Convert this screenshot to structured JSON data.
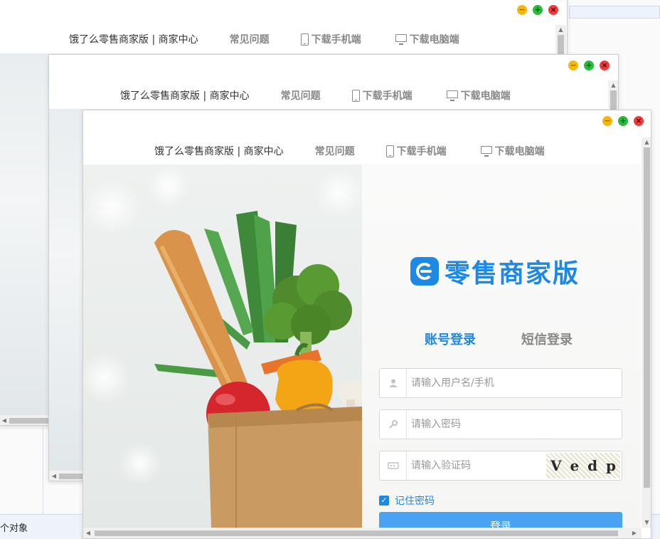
{
  "background": {
    "status_text": "个对象"
  },
  "windows": [
    {
      "nav": {
        "brand": "饿了么零售商家版 | 商家中心",
        "faq": "常见问题",
        "mobile": "下载手机端",
        "desktop": "下载电脑端"
      }
    },
    {
      "nav": {
        "brand": "饿了么零售商家版 | 商家中心",
        "faq": "常见问题",
        "mobile": "下载手机端",
        "desktop": "下载电脑端"
      }
    },
    {
      "nav": {
        "brand": "饿了么零售商家版 | 商家中心",
        "faq": "常见问题",
        "mobile": "下载手机端",
        "desktop": "下载电脑端"
      }
    }
  ],
  "login": {
    "logo_text": "零售商家版",
    "tabs": [
      "账号登录",
      "短信登录"
    ],
    "username_placeholder": "请输入用户名/手机",
    "password_placeholder": "请输入密码",
    "captcha_placeholder": "请输入验证码",
    "captcha_chars": [
      "V",
      "e",
      "d",
      "p"
    ],
    "remember_label": "记住密码",
    "login_button": "登录"
  },
  "colors": {
    "accent": "#1e88e5",
    "button": "#49a3f2"
  }
}
